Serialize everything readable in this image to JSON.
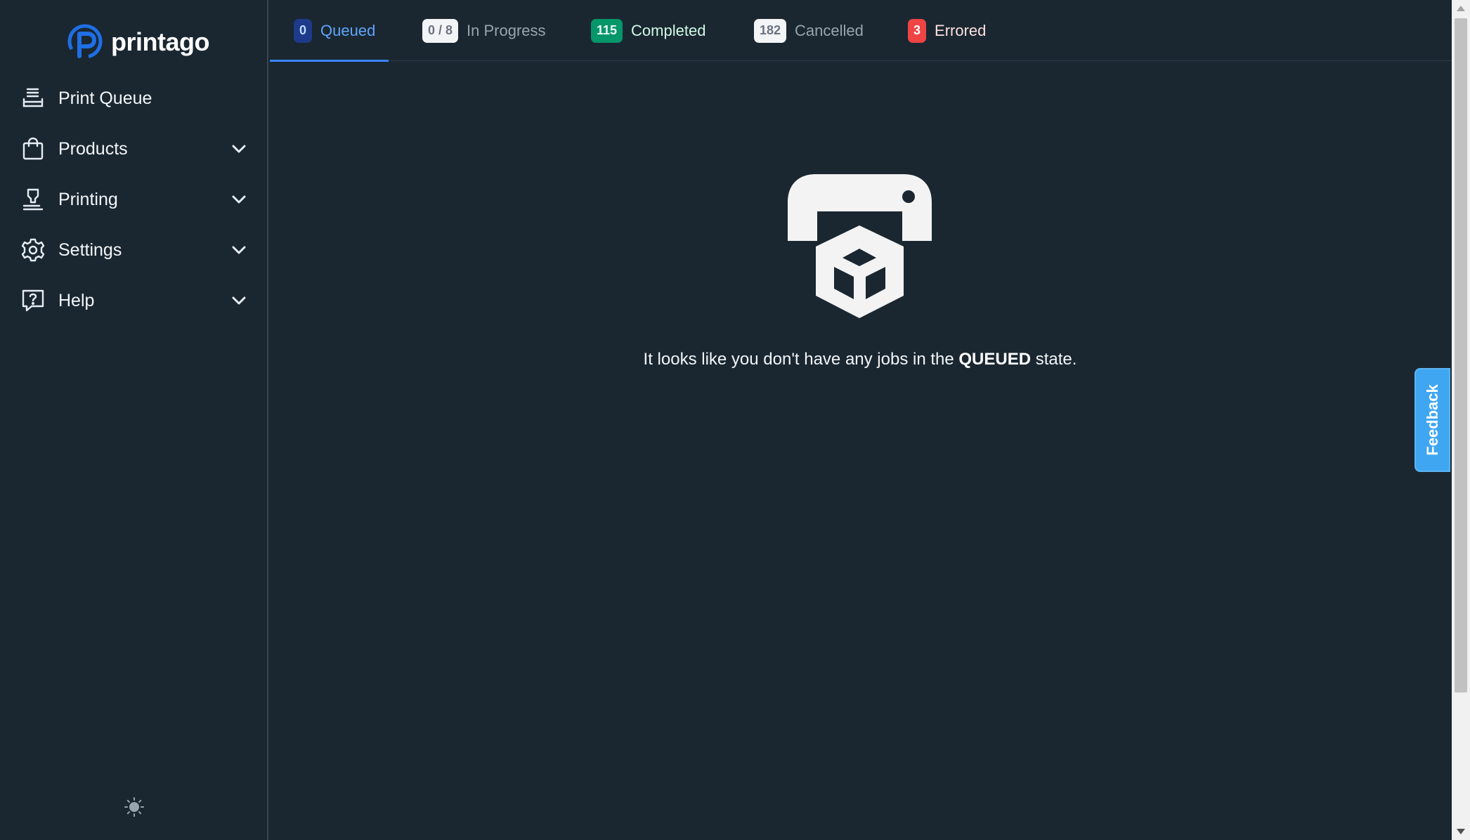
{
  "brand": {
    "name": "printago",
    "logo_color": "#1f6fe5"
  },
  "sidebar": {
    "items": [
      {
        "label": "Print Queue",
        "icon": "print-queue-icon",
        "has_submenu": false
      },
      {
        "label": "Products",
        "icon": "shopping-bag-icon",
        "has_submenu": true
      },
      {
        "label": "Printing",
        "icon": "printer-nozzle-icon",
        "has_submenu": true
      },
      {
        "label": "Settings",
        "icon": "gear-icon",
        "has_submenu": true
      },
      {
        "label": "Help",
        "icon": "help-chat-icon",
        "has_submenu": true
      }
    ],
    "theme_toggle_icon": "sun-icon"
  },
  "tabs": [
    {
      "count": "0",
      "label": "Queued",
      "active": true,
      "badge_bg": "#1e3a8a",
      "badge_fg": "#bfdbfe",
      "label_color": "#60a5fa"
    },
    {
      "count": "0 / 8",
      "label": "In Progress",
      "active": false,
      "badge_bg": "#f3f4f6",
      "badge_fg": "#6b7280",
      "label_color": "#9aa4ae"
    },
    {
      "count": "115",
      "label": "Completed",
      "active": false,
      "badge_bg": "#059669",
      "badge_fg": "#ecfdf5",
      "label_color": "#d1fae5"
    },
    {
      "count": "182",
      "label": "Cancelled",
      "active": false,
      "badge_bg": "#f3f4f6",
      "badge_fg": "#6b7280",
      "label_color": "#9aa4ae"
    },
    {
      "count": "3",
      "label": "Errored",
      "active": false,
      "badge_bg": "#ef4444",
      "badge_fg": "#ffffff",
      "label_color": "#fde2e2"
    }
  ],
  "empty_state": {
    "icon": "printer-box-icon",
    "text_before": "It looks like you don't have any jobs in the",
    "state": "QUEUED",
    "text_after": "state."
  },
  "feedback": {
    "label": "Feedback",
    "color": "#3fa6f2"
  }
}
